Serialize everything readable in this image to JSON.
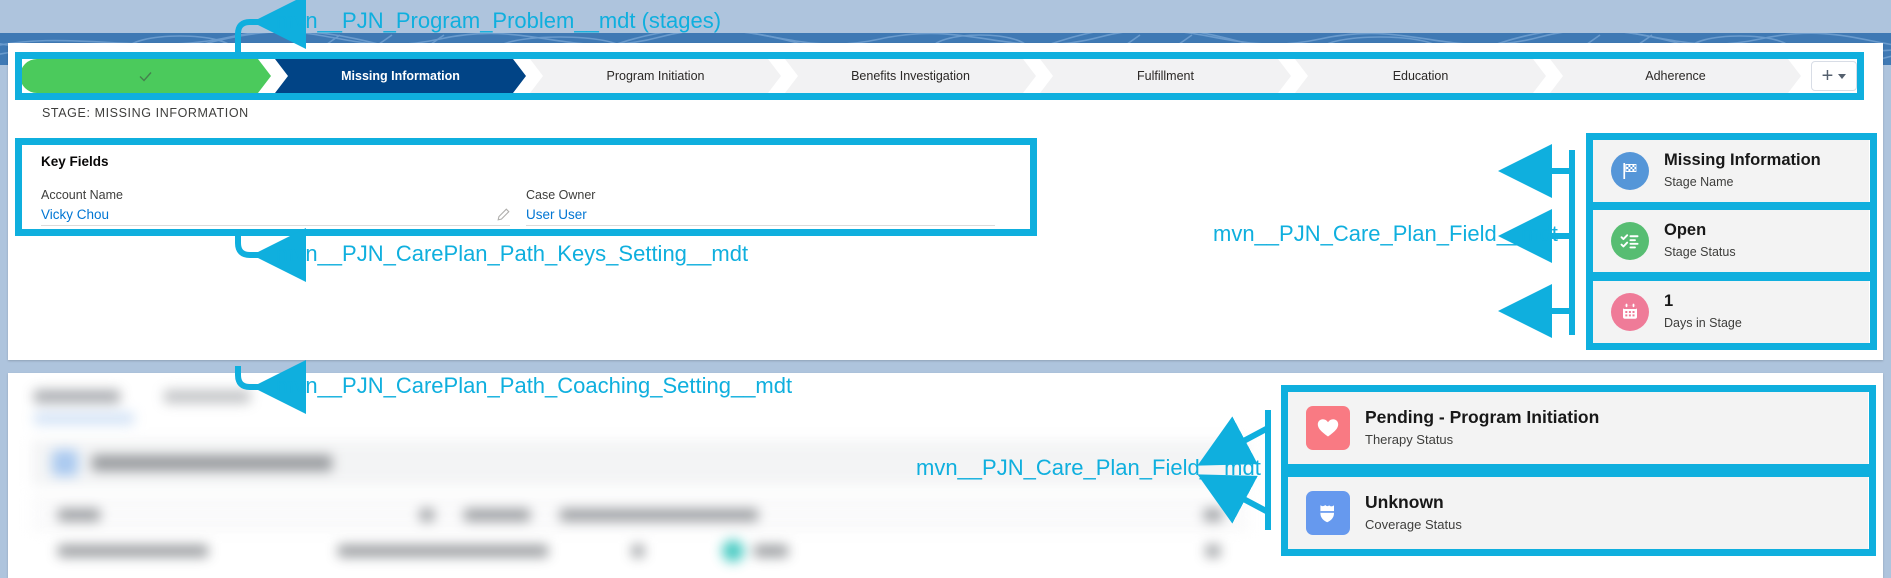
{
  "path": {
    "stages": [
      {
        "label": "",
        "state": "complete",
        "icon": "check-icon"
      },
      {
        "label": "Missing Information",
        "state": "current"
      },
      {
        "label": "Program Initiation",
        "state": "upcoming"
      },
      {
        "label": "Benefits Investigation",
        "state": "upcoming"
      },
      {
        "label": "Fulfillment",
        "state": "upcoming"
      },
      {
        "label": "Education",
        "state": "upcoming"
      },
      {
        "label": "Adherence",
        "state": "upcoming"
      }
    ],
    "add_button": {
      "icon": "plus-icon",
      "caret": "chevron-down-icon"
    }
  },
  "stage_caption": "STAGE: MISSING INFORMATION",
  "key_fields": {
    "heading": "Key Fields",
    "fields": [
      {
        "label": "Account Name",
        "value": "Vicky Chou",
        "editable": true
      },
      {
        "label": "Case Owner",
        "value": "User User",
        "editable": false
      }
    ]
  },
  "upper_cards": [
    {
      "title": "Missing Information",
      "subtitle": "Stage Name",
      "icon": "flag-icon",
      "icon_bg": "#5596d8",
      "shape": "circle"
    },
    {
      "title": "Open",
      "subtitle": "Stage Status",
      "icon": "checklist-icon",
      "icon_bg": "#57bd72",
      "shape": "circle"
    },
    {
      "title": "1",
      "subtitle": "Days in Stage",
      "icon": "calendar-icon",
      "icon_bg": "#ef7b98",
      "shape": "circle"
    }
  ],
  "lower_cards": [
    {
      "title": "Pending - Program Initiation",
      "subtitle": "Therapy Status",
      "icon": "heart-icon",
      "icon_bg": "#f97a83",
      "shape": "square"
    },
    {
      "title": "Unknown",
      "subtitle": "Coverage Status",
      "icon": "shield-icon",
      "icon_bg": "#6699ee",
      "shape": "square"
    }
  ],
  "annotations": [
    {
      "id": "a1",
      "text": "mvn__PJN_Program_Problem__mdt (stages)"
    },
    {
      "id": "a2",
      "text": "mvn__PJN_CarePlan_Path_Keys_Setting__mdt"
    },
    {
      "id": "a3",
      "text": "mvn__PJN_CarePlan_Path_Coaching_Setting__mdt"
    },
    {
      "id": "a4",
      "text": "mvn__PJN_Care_Plan_Field__mdt"
    },
    {
      "id": "a5",
      "text": "mvn__PJN_Care_Plan_Field__mdt"
    }
  ],
  "colors": {
    "annotation": "#0fafde",
    "stage_complete": "#4bca5c",
    "stage_current": "#014486",
    "stage_upcoming": "#f2f2f3",
    "link": "#0176d3",
    "page_bg": "#aec4dd",
    "topo_band": "#3f79b4"
  }
}
